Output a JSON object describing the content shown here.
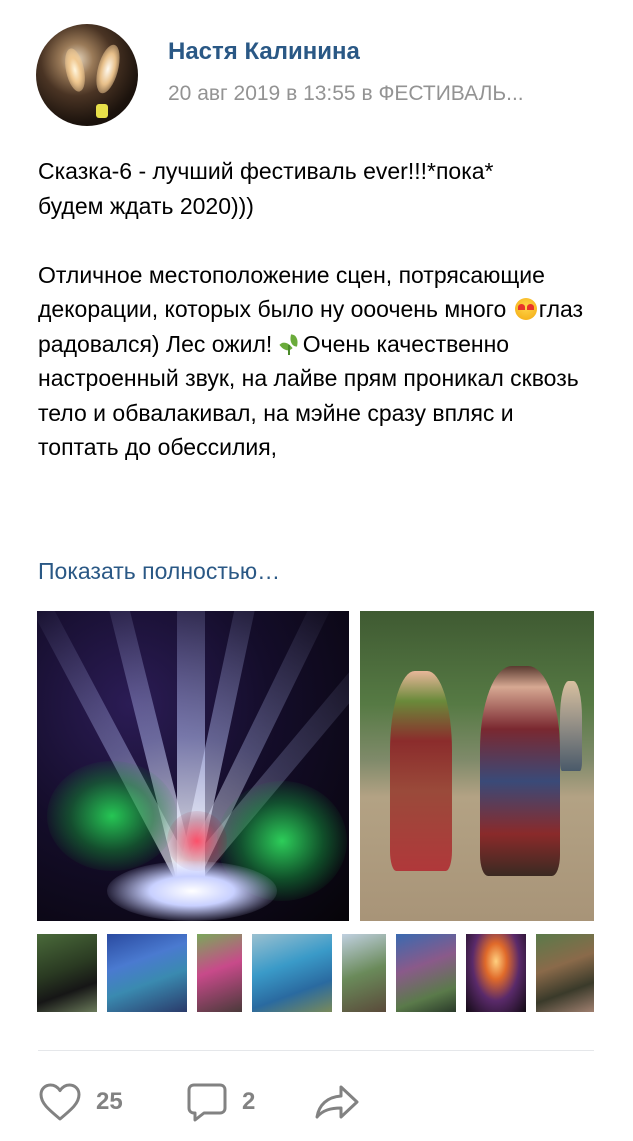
{
  "post": {
    "author": "Настя Калинина",
    "meta": "20 авг 2019 в 13:55 в ФЕСТИВАЛЬ...",
    "text": {
      "p1_line1": "Сказка-6 - лучший фестиваль ever!!!*пока*",
      "p1_line2": "будем ждать 2020)))",
      "p2_a": "Отличное местоположение сцен, потрясающие декорации, которых было ну ооочень много ",
      "p2_b": "глаз радовался) Лес ожил! ",
      "p2_c": "Очень качественно настроенный звук, на лайве прям проникал сквозь тело и обвалакивал, на мэйне сразу впляс и топтать до обессилия,"
    },
    "show_more": "Показать полностью…"
  },
  "emoji": {
    "heart_eyes": "smiling-face-with-heart-eyes",
    "leaf": "herb-leaf"
  },
  "photos": {
    "main": "laser-light-show-photo",
    "side": "dancers-photo",
    "thumbnails": [
      "thumbnail-1",
      "thumbnail-2",
      "thumbnail-3",
      "thumbnail-4",
      "thumbnail-5",
      "thumbnail-6",
      "thumbnail-7",
      "thumbnail-8"
    ]
  },
  "actions": {
    "likes": "25",
    "comments": "2",
    "icons": {
      "like": "heart-icon",
      "comment": "comment-icon",
      "share": "share-arrow-icon"
    }
  },
  "colors": {
    "link": "#2a5885",
    "meta": "#939393",
    "action": "#828282",
    "divider": "#e5e7ea"
  }
}
